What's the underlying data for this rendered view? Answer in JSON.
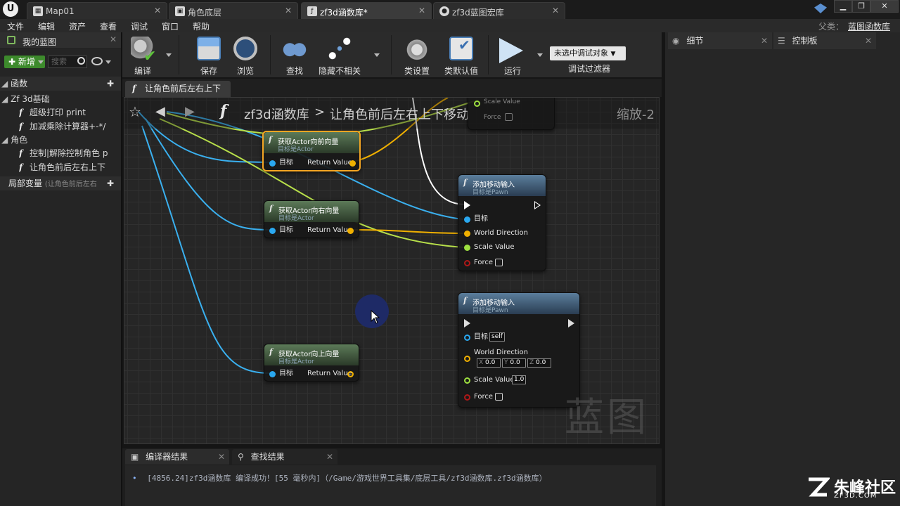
{
  "window": {
    "tabs": [
      {
        "label": "Map01",
        "icon": "map-icon"
      },
      {
        "label": "角色底层",
        "icon": "blueprint-icon"
      },
      {
        "label": "zf3d涵数库*",
        "icon": "function-library-icon"
      },
      {
        "label": "zf3d蓝图宏库",
        "icon": "macro-library-icon"
      }
    ],
    "parent_label": "父类：",
    "parent_value": "蓝图函数库"
  },
  "menu": [
    "文件",
    "编辑",
    "资产",
    "查看",
    "调试",
    "窗口",
    "帮助"
  ],
  "left_panel": {
    "tab_label": "我的蓝图",
    "new_button": "新增",
    "search_placeholder": "搜索",
    "functions_header": "函数",
    "group1": "Zf 3d基础",
    "group1_items": [
      "超级打印 print",
      "加减乘除计算器+-*/"
    ],
    "group2": "角色",
    "group2_items": [
      "控制|解除控制角色 p",
      "让角色前后左右上下"
    ],
    "local_vars": "局部变量",
    "local_vars_hint": "(让角色前后左右"
  },
  "toolbar": {
    "buttons": [
      "编译",
      "保存",
      "浏览",
      "查找",
      "隐藏不相关",
      "类设置",
      "类默认值",
      "运行"
    ],
    "debug_select": "未选中调试对象",
    "debug_filter": "调试过滤器"
  },
  "graph": {
    "tab_label": "让角色前后左右上下",
    "breadcrumb_root": "zf3d涵数库",
    "breadcrumb_sep": ">",
    "breadcrumb_leaf": "让角色前后左右上下移动",
    "zoom": "缩放-2",
    "watermark": "蓝图",
    "nodes": {
      "forward": {
        "title": "获取Actor向前向量",
        "subtitle": "目标是Actor",
        "in_pin": "目标",
        "out_pin": "Return Value"
      },
      "right": {
        "title": "获取Actor向右向量",
        "subtitle": "目标是Actor",
        "in_pin": "目标",
        "out_pin": "Return Value"
      },
      "up": {
        "title": "获取Actor向上向量",
        "subtitle": "目标是Actor",
        "in_pin": "目标",
        "out_pin": "Return Value"
      },
      "top_partial": {
        "scale": "Scale Value",
        "force": "Force"
      },
      "move1": {
        "title": "添加移动输入",
        "subtitle": "目标是Pawn",
        "target": "目标",
        "world_dir": "World Direction",
        "scale": "Scale Value",
        "force": "Force"
      },
      "move2": {
        "title": "添加移动输入",
        "subtitle": "目标是Pawn",
        "target": "目标",
        "self": "self",
        "world_dir": "World Direction",
        "x_label": "X",
        "x_val": "0.0",
        "y_label": "Y",
        "y_val": "0.0",
        "z_label": "Z",
        "z_val": "0.0",
        "scale": "Scale Value",
        "scale_val": "1.0",
        "force": "Force"
      }
    }
  },
  "right_panel": {
    "details_tab": "细节",
    "palette_tab": "控制板"
  },
  "bottom": {
    "compiler_tab": "编译器结果",
    "find_tab": "查找结果",
    "log": "[4856.24]zf3d涵数库 编译成功！[55 毫秒内]（/Game/游戏世界工具集/底层工具/zf3d涵数库.zf3d涵数库）"
  },
  "brand": {
    "name": "朱峰社区",
    "site": "ZF3D.COM"
  },
  "colors": {
    "exec": "#ffffff",
    "object_pin": "#2aa8f0",
    "vector_pin": "#f0b000",
    "float_pin": "#9ee040",
    "bool_pin": "#b01818",
    "selected": "#f5a623",
    "new_button": "#3d8a2c"
  }
}
